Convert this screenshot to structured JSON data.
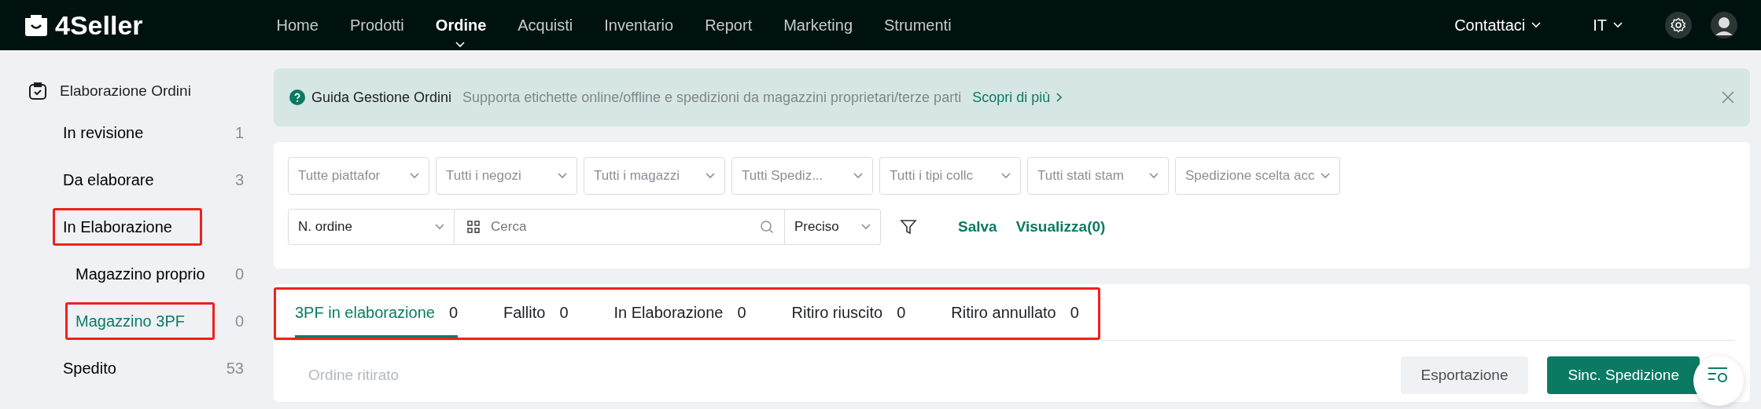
{
  "brand": {
    "name": "4Seller"
  },
  "nav": [
    {
      "label": "Home",
      "selected": false
    },
    {
      "label": "Prodotti",
      "selected": false
    },
    {
      "label": "Ordine",
      "selected": true
    },
    {
      "label": "Acquisti",
      "selected": false
    },
    {
      "label": "Inventario",
      "selected": false
    },
    {
      "label": "Report",
      "selected": false
    },
    {
      "label": "Marketing",
      "selected": false
    },
    {
      "label": "Strumenti",
      "selected": false
    }
  ],
  "topbar": {
    "contact": "Contattaci",
    "language": "IT"
  },
  "sidebar": {
    "title": "Elaborazione Ordini",
    "items": [
      {
        "label": "In revisione",
        "count": "1",
        "selected": false,
        "highlighted": false
      },
      {
        "label": "Da elaborare",
        "count": "3",
        "selected": false,
        "highlighted": false
      },
      {
        "label": "In Elaborazione",
        "selected": false,
        "highlighted": true,
        "children": [
          {
            "label": "Magazzino proprio",
            "count": "0",
            "selected": false,
            "highlighted": false
          },
          {
            "label": "Magazzino 3PF",
            "count": "0",
            "selected": true,
            "highlighted": true
          }
        ]
      },
      {
        "label": "Spedito",
        "count": "53",
        "selected": false,
        "highlighted": false
      }
    ]
  },
  "banner": {
    "title": "Guida Gestione Ordini",
    "text": "Supporta etichette online/offline e spedizioni da magazzini proprietari/terze parti",
    "link": "Scopri di più"
  },
  "filters": [
    "Tutte piattafor",
    "Tutti i negozi",
    "Tutti i magazzi",
    "Tutti Spediz...",
    "Tutti i tipi collc",
    "Tutti stati stam",
    "Spedizione scelta acc"
  ],
  "search": {
    "field_type": "N. ordine",
    "placeholder": "Cerca",
    "match": "Preciso",
    "save": "Salva",
    "view": "Visualizza(0)"
  },
  "tabs": {
    "highlighted": true,
    "items": [
      {
        "label": "3PF in elaborazione",
        "count": "0",
        "selected": true
      },
      {
        "label": "Fallito",
        "count": "0",
        "selected": false
      },
      {
        "label": "In Elaborazione",
        "count": "0",
        "selected": false
      },
      {
        "label": "Ritiro riuscito",
        "count": "0",
        "selected": false
      },
      {
        "label": "Ritiro annullato",
        "count": "0",
        "selected": false
      }
    ]
  },
  "toolbar": {
    "status": "Ordine ritirato",
    "buttons": [
      {
        "label": "Esportazione",
        "kind": "secondary"
      },
      {
        "label": "Sinc. Spedizione",
        "kind": "primary"
      }
    ]
  }
}
